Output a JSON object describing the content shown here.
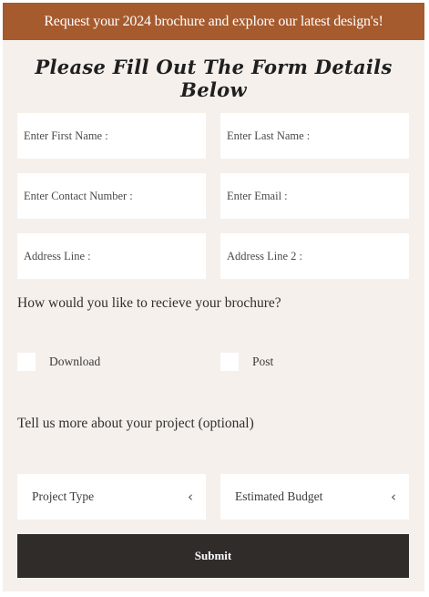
{
  "banner": {
    "text": "Request your 2024 brochure and explore our latest design's!"
  },
  "form": {
    "title": "Please Fill Out The Form Details Below",
    "fields": {
      "first_name": "Enter First Name :",
      "last_name": "Enter Last Name :",
      "contact": "Enter Contact Number :",
      "email": "Enter Email :",
      "address1": "Address Line :",
      "address2": "Address Line 2 :"
    },
    "brochure_question": "How would you like to recieve your brochure?",
    "options": {
      "download": "Download",
      "post": "Post"
    },
    "project_question": "Tell us more about your project (optional)",
    "selects": {
      "project_type": "Project Type",
      "budget": "Estimated Budget",
      "chevron_icon": "chevron-left-icon"
    },
    "submit_label": "Submit"
  }
}
